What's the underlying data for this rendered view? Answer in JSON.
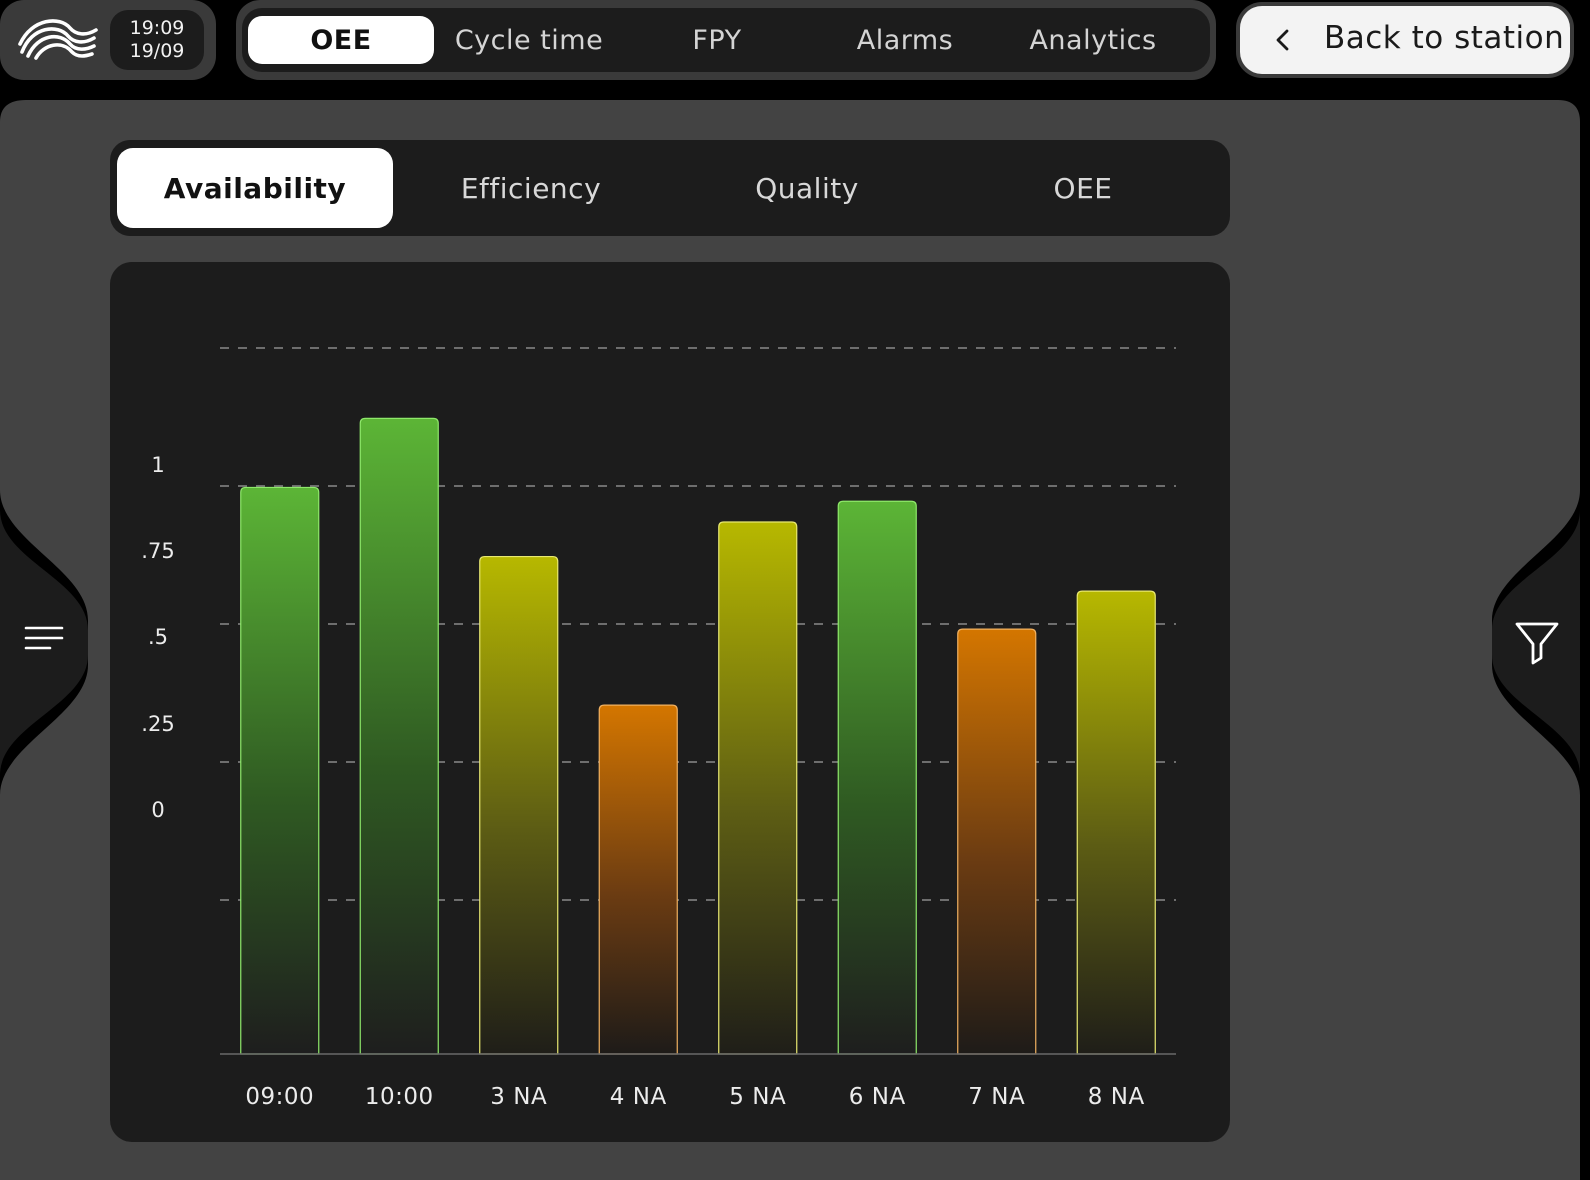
{
  "status": {
    "time": "19:09",
    "date": "19/09"
  },
  "nav": {
    "tabs": [
      "OEE",
      "Cycle time",
      "FPY",
      "Alarms",
      "Analytics"
    ],
    "active": 0,
    "back_label": "Back to station"
  },
  "subtabs": {
    "items": [
      "Availability",
      "Efficiency",
      "Quality",
      "OEE"
    ],
    "active": 0
  },
  "icons": {
    "logo": "wave-logo-icon",
    "back": "chevron-left-icon",
    "menu": "hamburger-menu-icon",
    "filter": "filter-funnel-icon"
  },
  "colors": {
    "green": "#5ab334",
    "yellow": "#b3b300",
    "orange": "#cc7300",
    "background": "#000000",
    "panel": "#434343",
    "card": "#1c1c1c"
  },
  "chart_data": {
    "type": "bar",
    "categories": [
      "09:00",
      "10:00",
      "3 NA",
      "4 NA",
      "5 NA",
      "6 NA",
      "7 NA",
      "8 NA"
    ],
    "values": [
      0.94,
      1.14,
      0.74,
      0.31,
      0.84,
      0.9,
      0.53,
      0.64
    ],
    "bar_colors": [
      "green",
      "green",
      "yellow",
      "orange",
      "yellow",
      "green",
      "orange",
      "yellow"
    ],
    "y_ticks": [
      {
        "value": 1,
        "label": "1"
      },
      {
        "value": 0.75,
        "label": ".75"
      },
      {
        "value": 0.5,
        "label": ".5"
      },
      {
        "value": 0.25,
        "label": ".25"
      },
      {
        "value": 0,
        "label": "0"
      }
    ],
    "ylim": [
      -0.7,
      1.39
    ],
    "grid": "dashed horizontal",
    "title": "",
    "xlabel": "",
    "ylabel": ""
  }
}
